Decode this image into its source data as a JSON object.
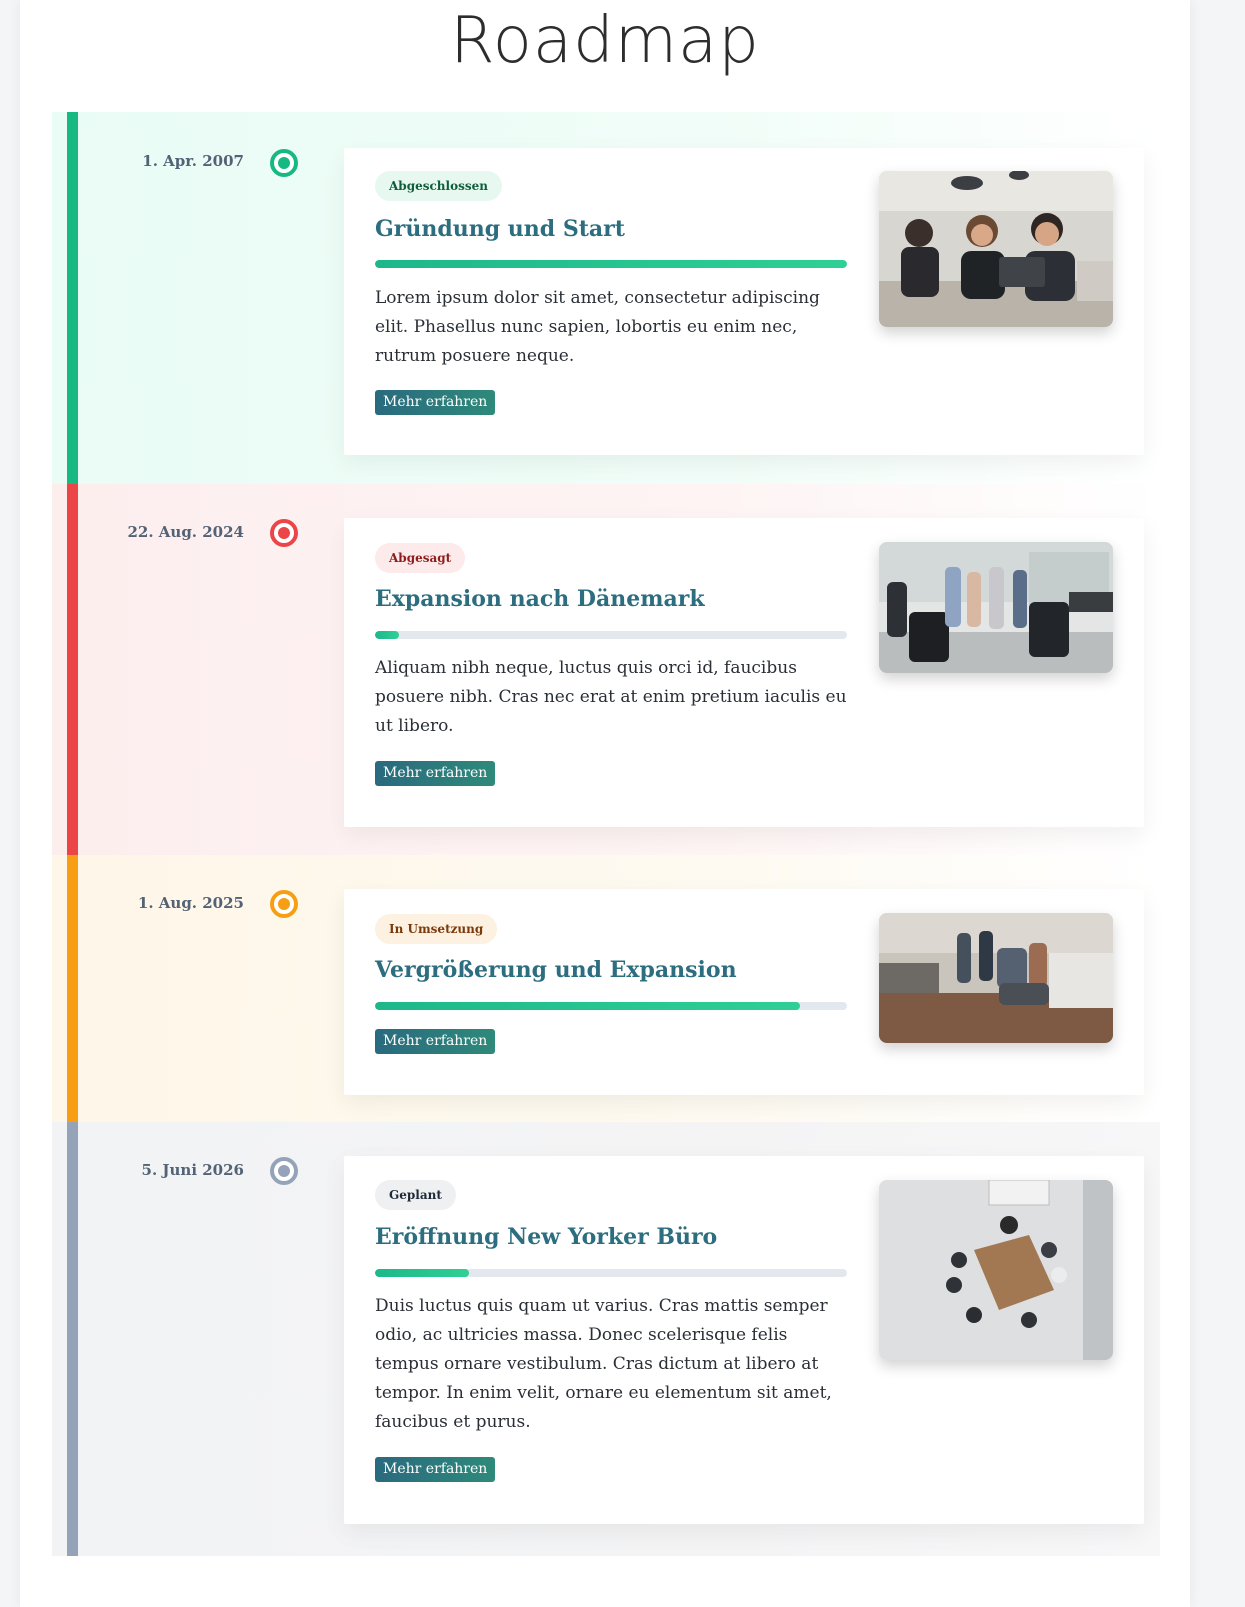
{
  "page": {
    "title": "Roadmap"
  },
  "entries": [
    {
      "date": "1. Apr. 2007",
      "status": "Abgeschlossen",
      "title": "Gründung und Start",
      "progress": 1.0,
      "description": "Lorem ipsum dolor sit amet, consectetur adipiscing elit. Phasellus nunc sapien, lobortis eu enim nec, rutrum posuere neque.",
      "button": "Mehr erfahren",
      "color": "#17b982",
      "image": "team-laptop-photo"
    },
    {
      "date": "22. Aug. 2024",
      "status": "Abgesagt",
      "title": "Expansion nach Dänemark",
      "progress": 0.05,
      "description": "Aliquam nibh neque, luctus quis orci id, faucibus posuere nibh. Cras nec erat at enim pretium iaculis eu ut libero.",
      "button": "Mehr erfahren",
      "color": "#ec4548",
      "image": "office-meeting-photo"
    },
    {
      "date": "1. Aug. 2025",
      "status": "In Umsetzung",
      "title": "Vergrößerung und Expansion",
      "progress": 0.9,
      "description": "",
      "button": "Mehr erfahren",
      "color": "#f89e14",
      "image": "team-highfive-photo"
    },
    {
      "date": "5. Juni 2026",
      "status": "Geplant",
      "title": "Eröffnung New Yorker Büro",
      "progress": 0.2,
      "description": "Duis luctus quis quam ut varius. Cras mattis semper odio, ac ultricies massa. Donec scelerisque felis tempus ornare vestibulum. Cras dictum at libero at tempor. In enim velit, ornare eu elementum sit amet, faucibus et purus.",
      "button": "Mehr erfahren",
      "color": "#94a3b8",
      "image": "conference-table-photo"
    }
  ]
}
